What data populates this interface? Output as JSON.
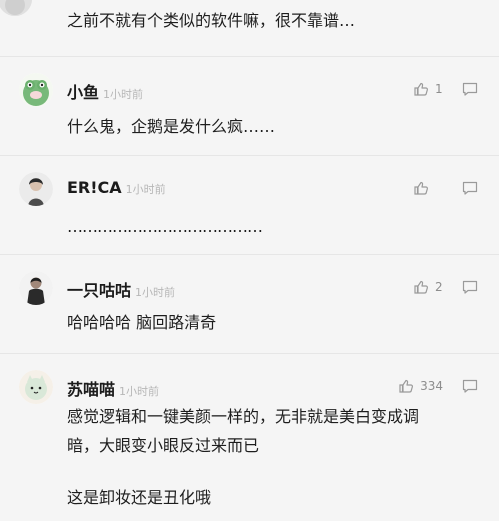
{
  "feed": {
    "top_comment": {
      "text": "之前不就有个类似的软件嘛，很不靠谱…"
    },
    "comments": [
      {
        "name": "小鱼",
        "time": "1小时前",
        "text_lines": [
          "什么鬼，企鹅是发什么疯……"
        ],
        "likes": "1"
      },
      {
        "name": "ER!CA",
        "time": "1小时前",
        "text_lines": [
          "…………………………………"
        ],
        "likes": ""
      },
      {
        "name": "一只咕咕",
        "time": "1小时前",
        "text_lines": [
          "哈哈哈哈 脑回路清奇"
        ],
        "likes": "2"
      },
      {
        "name": "苏喵喵",
        "time": "1小时前",
        "text_lines": [
          "感觉逻辑和一键美颜一样的，无非就是美白变成调",
          "暗，大眼变小眼反过来而已",
          "",
          "这是卸妆还是丑化哦"
        ],
        "likes": "334"
      }
    ]
  },
  "icons": {
    "like": "thumbs-up-icon",
    "reply": "comment-bubble-icon"
  }
}
